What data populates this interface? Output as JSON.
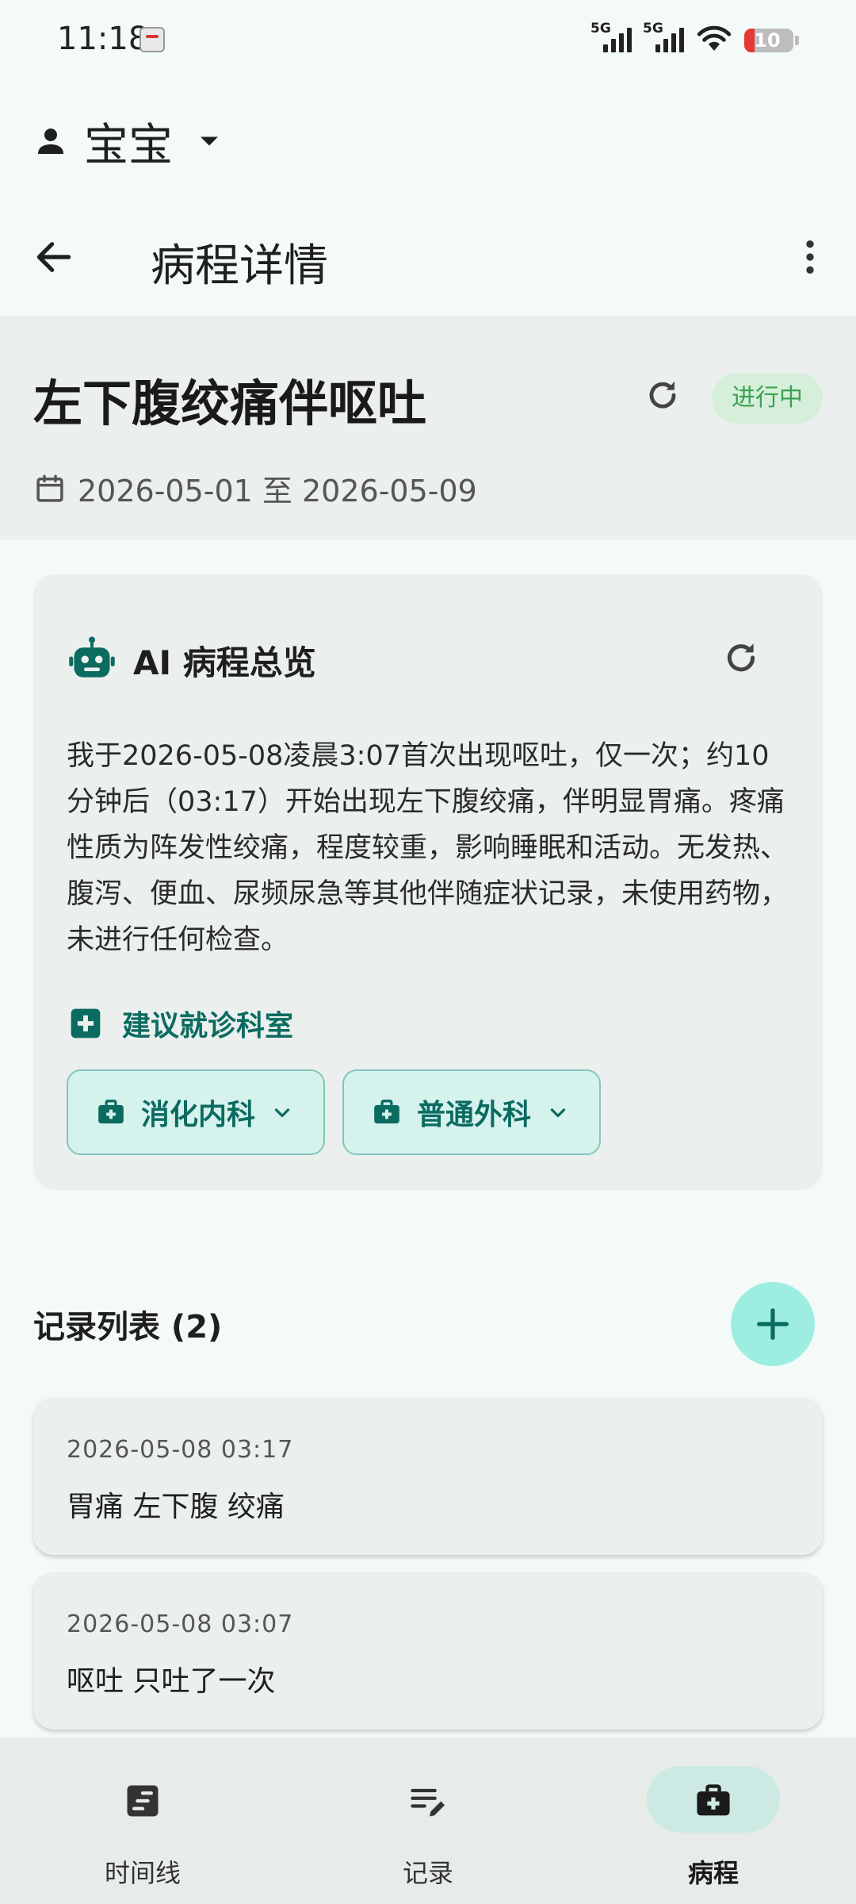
{
  "status_bar": {
    "time": "11:18",
    "network_1": "5G",
    "network_2": "5G",
    "battery": "10"
  },
  "profile": {
    "name": "宝宝"
  },
  "app_bar": {
    "title": "病程详情"
  },
  "episode": {
    "title": "左下腹绞痛伴呕吐",
    "status": "进行中",
    "status_color": "#3aa251",
    "date_range": "2026-05-01 至 2026-05-09"
  },
  "ai_overview": {
    "title": "AI 病程总览",
    "summary": "我于2026-05-08凌晨3:07首次出现呕吐，仅一次；约10分钟后（03:17）开始出现左下腹绞痛，伴明显胃痛。疼痛性质为阵发性绞痛，程度较重，影响睡眠和活动。无发热、腹泻、便血、尿频尿急等其他伴随症状记录，未使用药物，未进行任何检查。",
    "suggest_label": "建议就诊科室",
    "departments": [
      "消化内科",
      "普通外科"
    ]
  },
  "records": {
    "title": "记录列表 (2)",
    "items": [
      {
        "time": "2026-05-08 03:17",
        "text": "胃痛 左下腹 绞痛"
      },
      {
        "time": "2026-05-08 03:07",
        "text": "呕吐 只吐了一次"
      }
    ]
  },
  "bottom_nav": {
    "items": [
      {
        "label": "时间线",
        "icon": "timeline-icon"
      },
      {
        "label": "记录",
        "icon": "edit-note-icon"
      },
      {
        "label": "病程",
        "icon": "medical-bag-icon"
      }
    ],
    "active": "病程"
  },
  "colors": {
    "accent": "#0c6b60",
    "fab": "#9deee0",
    "chip": "#d6f2ed"
  }
}
